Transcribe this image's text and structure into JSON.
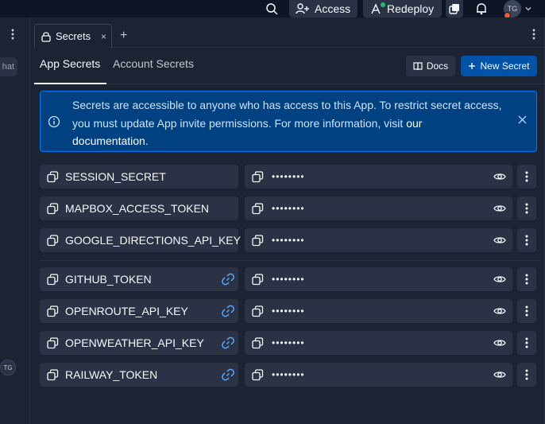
{
  "topbar": {
    "access_label": "Access",
    "redeploy_label": "Redeploy",
    "avatar_initials": "TG"
  },
  "leftrail": {
    "chat_label": "hat",
    "avatar_initials": "TG"
  },
  "tab": {
    "label": "Secrets",
    "close": "×",
    "add": "+"
  },
  "subtabs": {
    "app": "App Secrets",
    "account": "Account Secrets"
  },
  "buttons": {
    "docs": "Docs",
    "new_secret": "New Secret"
  },
  "banner": {
    "text_main": "Secrets are accessible to anyone who has access to this App. To restrict secret access, you must update App invite permissions. For more information, visit ",
    "link_our": "our",
    "link_doc": "documentation",
    "text_end": "."
  },
  "masked_value": "••••••••",
  "app_secrets": [
    {
      "key": "SESSION_SECRET"
    },
    {
      "key": "MAPBOX_ACCESS_TOKEN"
    },
    {
      "key": "GOOGLE_DIRECTIONS_API_KEY"
    }
  ],
  "linked_secrets": [
    {
      "key": "GITHUB_TOKEN"
    },
    {
      "key": "OPENROUTE_API_KEY"
    },
    {
      "key": "OPENWEATHER_API_KEY"
    },
    {
      "key": "RAILWAY_TOKEN"
    }
  ],
  "colors": {
    "background": "#1c2333",
    "surface": "#2b3245",
    "primary_button": "#0053a6",
    "banner_bg": "#004182",
    "banner_border": "#0079f2",
    "link_icon": "#57abff"
  }
}
